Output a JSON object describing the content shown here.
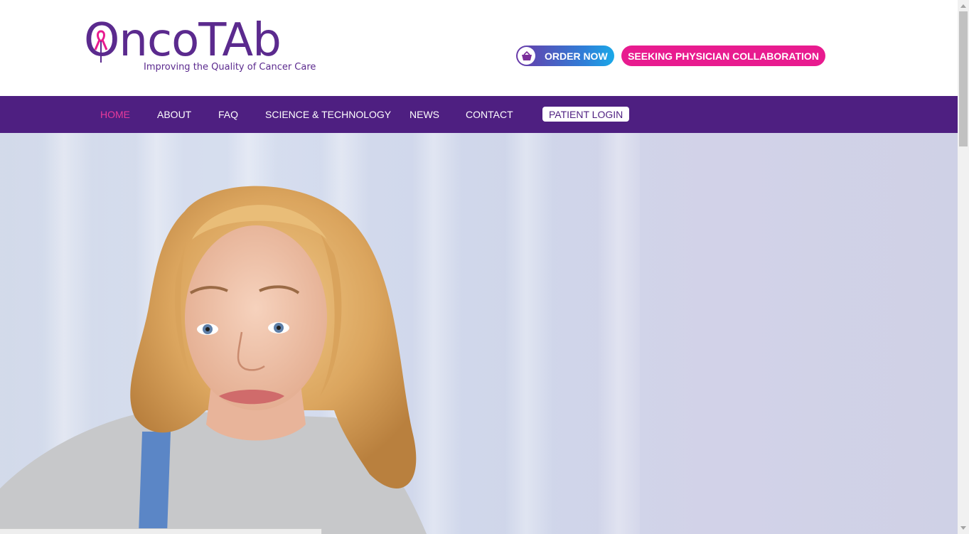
{
  "brand": {
    "name": "OncoTAb",
    "tagline": "Improving the Quality of Cancer Care",
    "primary_color": "#4e1f81",
    "accent_color": "#e81b8f"
  },
  "header": {
    "order_button": {
      "label": "ORDER NOW",
      "icon": "basket-icon"
    },
    "collab_button": {
      "label": "SEEKING PHYSICIAN COLLABORATION"
    }
  },
  "nav": {
    "items": [
      {
        "label": "HOME",
        "active": true
      },
      {
        "label": "ABOUT"
      },
      {
        "label": "FAQ"
      },
      {
        "label": "SCIENCE & TECHNOLOGY"
      },
      {
        "label": "NEWS"
      },
      {
        "label": "CONTACT"
      }
    ],
    "login_label": "PATIENT LOGIN"
  },
  "hero": {
    "image": "smiling-woman-portrait"
  }
}
